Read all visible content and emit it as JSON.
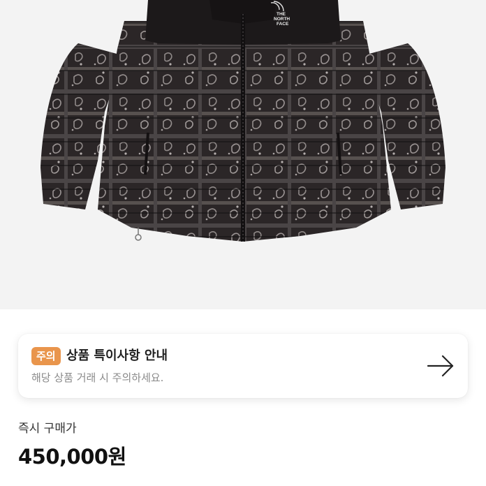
{
  "product_image": {
    "alt": "THE NORTH FACE bandana print puffer jacket",
    "logo_text": [
      "THE",
      "NORTH",
      "FACE"
    ]
  },
  "notice": {
    "badge": "주의",
    "title": "상품 특이사항 안내",
    "description": "해당 상품 거래 시 주의하세요.",
    "arrow_icon": "arrow-right-icon"
  },
  "price": {
    "label": "즉시 구매가",
    "value": "450,000원"
  },
  "colors": {
    "badge": "#e9954c",
    "jacket": "#2a2627",
    "image_background": "#f3f3f3"
  }
}
